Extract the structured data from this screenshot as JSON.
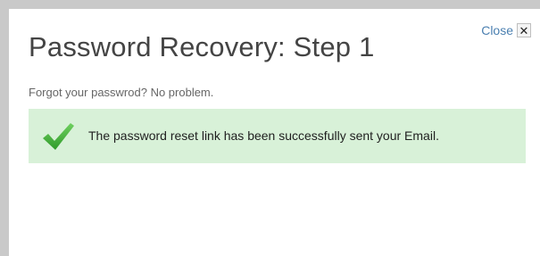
{
  "dialog": {
    "title": "Password Recovery: Step 1",
    "subtitle": "Forgot your passwrod? No problem.",
    "close_label": "Close",
    "close_glyph": "✕"
  },
  "alert": {
    "message": "The password reset link has been successfully sent your Email.",
    "icon": "checkmark-icon",
    "background_color": "#d8f1d8",
    "icon_color": "#46b33c"
  }
}
